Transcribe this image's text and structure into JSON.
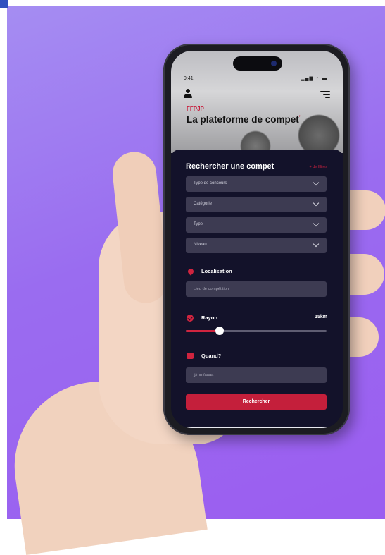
{
  "status_bar": {
    "time": "9:41",
    "icons": "▂▄▆ ◔ ▬"
  },
  "header": {
    "brand": "FFPJP",
    "title": "La plateforme de compet",
    "title_mark": "’"
  },
  "search_panel": {
    "title": "Rechercher une compet",
    "more_filters": "+ de filtres",
    "selects": [
      {
        "label": "Type de concours"
      },
      {
        "label": "Catégorie"
      },
      {
        "label": "Type"
      },
      {
        "label": "Niveau"
      }
    ],
    "location": {
      "label": "Localisation",
      "placeholder": "Lieu de compétition"
    },
    "radius": {
      "label": "Rayon",
      "value_text": "15km",
      "slider_fraction": 0.24
    },
    "when": {
      "label": "Quand?",
      "placeholder": "jj/mm/aaaa"
    },
    "submit_label": "Rechercher"
  },
  "colors": {
    "accent": "#c8203f",
    "panel": "#13122a",
    "field": "#3d3b52",
    "background": "#9b6cf0"
  },
  "icons": [
    "user-icon",
    "menu-icon",
    "chevron-down-icon",
    "location-pin-icon",
    "radius-check-icon",
    "calendar-icon"
  ]
}
